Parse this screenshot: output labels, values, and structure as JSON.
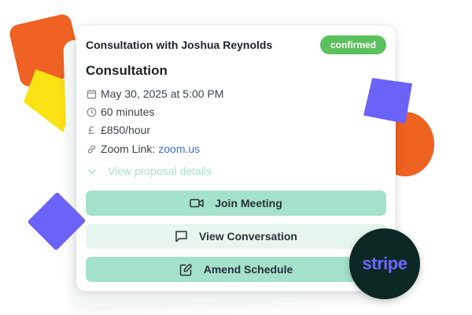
{
  "card": {
    "title": "Consultation with Joshua Reynolds",
    "status": "confirmed",
    "proposal_title": "Consultation",
    "date": "May 30, 2025 at 5:00 PM",
    "duration": "60 minutes",
    "price": "£850/hour",
    "price_symbol": "£",
    "zoom_label": "Zoom Link:",
    "zoom_link": "zoom.us",
    "proposal_toggle": "View proposal details"
  },
  "actions": {
    "join": "Join Meeting",
    "conversation": "View Conversation",
    "amend": "Amend Schedule"
  },
  "brand": {
    "stripe_logo": "stripe"
  },
  "icons": {
    "date": "calendar-icon",
    "duration": "clock-icon",
    "price": "pound-icon",
    "zoom": "link-icon",
    "toggle": "chevron-down-icon",
    "join": "video-icon",
    "conversation": "chat-icon",
    "amend": "edit-icon"
  },
  "colors": {
    "status": "#5bc15e",
    "primary_button": "#a4e2cc",
    "secondary_button": "#e7f6ef",
    "link": "#3f6bd8",
    "accent_orange": "#ef6223",
    "accent_purple": "#6b63f7",
    "accent_yellow": "#fbe214",
    "stripe_bg": "#0c2824",
    "stripe_text": "#6f66ff"
  }
}
